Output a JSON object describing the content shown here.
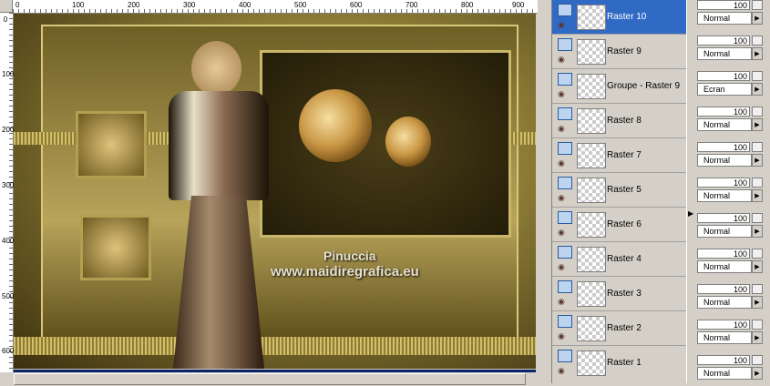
{
  "ruler": {
    "top_ticks": [
      "0",
      "100",
      "200",
      "300",
      "400",
      "500",
      "600",
      "700",
      "800",
      "900"
    ],
    "left_ticks": [
      "0",
      "100",
      "200",
      "300",
      "400",
      "500",
      "600"
    ]
  },
  "canvas": {
    "watermark_line1": "Pinuccia",
    "watermark_line2": "www.maidiregrafica.eu"
  },
  "layers": [
    {
      "name": "Raster 10",
      "selected": true,
      "opacity": "100",
      "blend": "Normal"
    },
    {
      "name": "Raster 9",
      "selected": false,
      "opacity": "100",
      "blend": "Normal"
    },
    {
      "name": "Groupe - Raster 9",
      "selected": false,
      "opacity": "100",
      "blend": "Ecran"
    },
    {
      "name": "Raster 8",
      "selected": false,
      "opacity": "100",
      "blend": "Normal"
    },
    {
      "name": "Raster 7",
      "selected": false,
      "opacity": "100",
      "blend": "Normal"
    },
    {
      "name": "Raster 5",
      "selected": false,
      "opacity": "100",
      "blend": "Normal"
    },
    {
      "name": "Raster 6",
      "selected": false,
      "opacity": "100",
      "blend": "Normal"
    },
    {
      "name": "Raster 4",
      "selected": false,
      "opacity": "100",
      "blend": "Normal"
    },
    {
      "name": "Raster 3",
      "selected": false,
      "opacity": "100",
      "blend": "Normal"
    },
    {
      "name": "Raster 2",
      "selected": false,
      "opacity": "100",
      "blend": "Normal"
    },
    {
      "name": "Raster 1",
      "selected": false,
      "opacity": "100",
      "blend": "Normal"
    }
  ],
  "colors": {
    "selection": "#316ac5",
    "panel": "#d4d0c8"
  }
}
